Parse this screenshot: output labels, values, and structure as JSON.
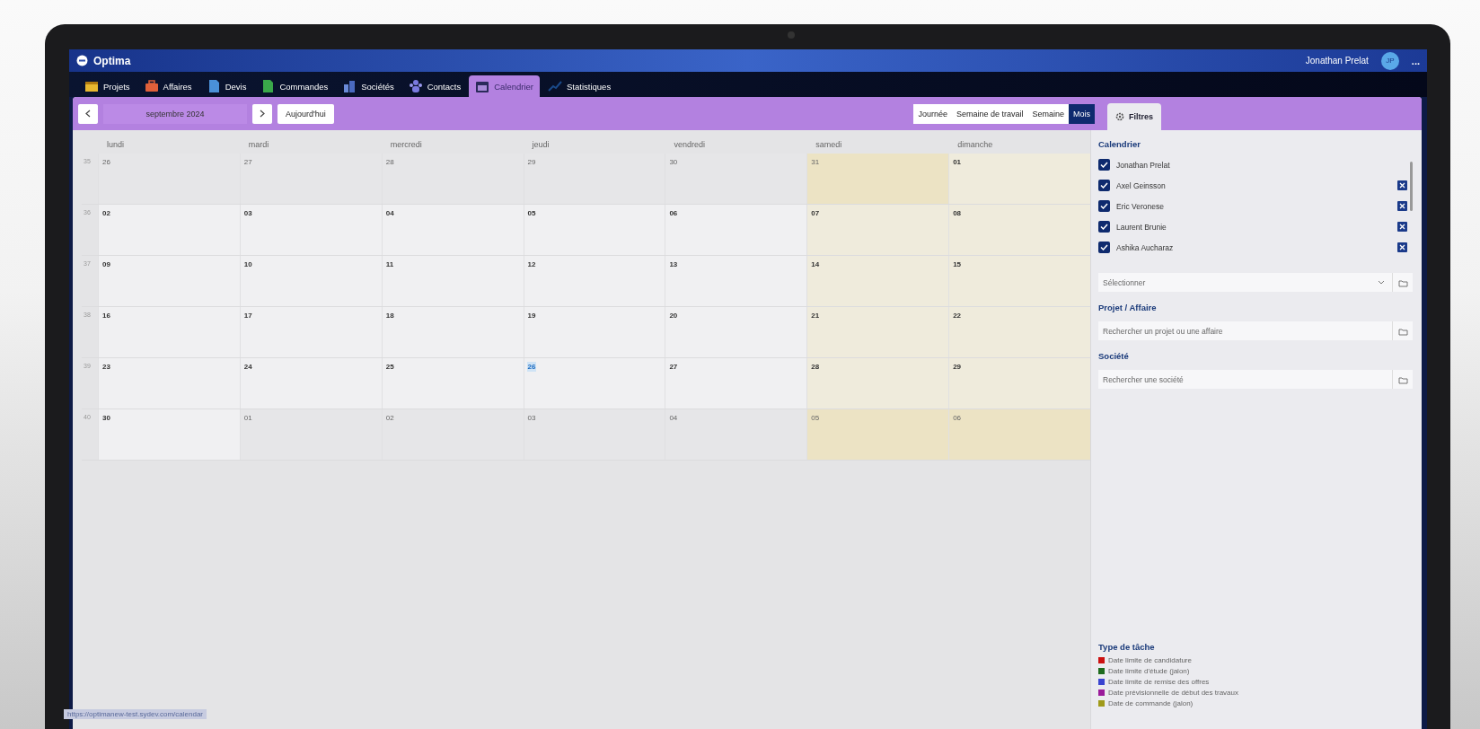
{
  "app": {
    "name": "Optima"
  },
  "user": {
    "name": "Jonathan Prelat",
    "initials": "JP",
    "menu": "..."
  },
  "nav": [
    {
      "label": "Projets",
      "selected": false
    },
    {
      "label": "Affaires",
      "selected": false
    },
    {
      "label": "Devis",
      "selected": false
    },
    {
      "label": "Commandes",
      "selected": false
    },
    {
      "label": "Sociétés",
      "selected": false
    },
    {
      "label": "Contacts",
      "selected": false
    },
    {
      "label": "Calendrier",
      "selected": true
    },
    {
      "label": "Statistiques",
      "selected": false
    }
  ],
  "toolbar": {
    "period": "septembre 2024",
    "today_button": "Aujourd'hui",
    "views": [
      {
        "label": "Journée",
        "selected": false
      },
      {
        "label": "Semaine de travail",
        "selected": false
      },
      {
        "label": "Semaine",
        "selected": false
      },
      {
        "label": "Mois",
        "selected": true
      }
    ]
  },
  "calendar": {
    "weekdays": [
      "lundi",
      "mardi",
      "mercredi",
      "jeudi",
      "vendredi",
      "samedi",
      "dimanche"
    ],
    "weeks": [
      {
        "number": "35",
        "days": [
          {
            "day": "26",
            "outside": true,
            "today": false
          },
          {
            "day": "27",
            "outside": true,
            "today": false
          },
          {
            "day": "28",
            "outside": true,
            "today": false
          },
          {
            "day": "29",
            "outside": true,
            "today": false
          },
          {
            "day": "30",
            "outside": true,
            "today": false
          },
          {
            "day": "31",
            "outside": true,
            "today": false
          },
          {
            "day": "01",
            "outside": false,
            "today": false
          }
        ]
      },
      {
        "number": "36",
        "days": [
          {
            "day": "02",
            "outside": false,
            "today": false
          },
          {
            "day": "03",
            "outside": false,
            "today": false
          },
          {
            "day": "04",
            "outside": false,
            "today": false
          },
          {
            "day": "05",
            "outside": false,
            "today": false
          },
          {
            "day": "06",
            "outside": false,
            "today": false
          },
          {
            "day": "07",
            "outside": false,
            "today": false
          },
          {
            "day": "08",
            "outside": false,
            "today": false
          }
        ]
      },
      {
        "number": "37",
        "days": [
          {
            "day": "09",
            "outside": false,
            "today": false
          },
          {
            "day": "10",
            "outside": false,
            "today": false
          },
          {
            "day": "11",
            "outside": false,
            "today": false
          },
          {
            "day": "12",
            "outside": false,
            "today": false
          },
          {
            "day": "13",
            "outside": false,
            "today": false
          },
          {
            "day": "14",
            "outside": false,
            "today": false
          },
          {
            "day": "15",
            "outside": false,
            "today": false
          }
        ]
      },
      {
        "number": "38",
        "days": [
          {
            "day": "16",
            "outside": false,
            "today": false
          },
          {
            "day": "17",
            "outside": false,
            "today": false
          },
          {
            "day": "18",
            "outside": false,
            "today": false
          },
          {
            "day": "19",
            "outside": false,
            "today": false
          },
          {
            "day": "20",
            "outside": false,
            "today": false
          },
          {
            "day": "21",
            "outside": false,
            "today": false
          },
          {
            "day": "22",
            "outside": false,
            "today": false
          }
        ]
      },
      {
        "number": "39",
        "days": [
          {
            "day": "23",
            "outside": false,
            "today": false
          },
          {
            "day": "24",
            "outside": false,
            "today": false
          },
          {
            "day": "25",
            "outside": false,
            "today": false
          },
          {
            "day": "26",
            "outside": false,
            "today": true
          },
          {
            "day": "27",
            "outside": false,
            "today": false
          },
          {
            "day": "28",
            "outside": false,
            "today": false
          },
          {
            "day": "29",
            "outside": false,
            "today": false
          }
        ]
      },
      {
        "number": "40",
        "days": [
          {
            "day": "30",
            "outside": false,
            "today": false
          },
          {
            "day": "01",
            "outside": true,
            "today": false
          },
          {
            "day": "02",
            "outside": true,
            "today": false
          },
          {
            "day": "03",
            "outside": true,
            "today": false
          },
          {
            "day": "04",
            "outside": true,
            "today": false
          },
          {
            "day": "05",
            "outside": true,
            "today": false
          },
          {
            "day": "06",
            "outside": true,
            "today": false
          }
        ]
      }
    ]
  },
  "filters": {
    "tab": "Filtres",
    "calendar_title": "Calendrier",
    "people": [
      {
        "name": "Jonathan Prelat",
        "checked": true,
        "removable": false
      },
      {
        "name": "Axel Geinsson",
        "checked": true,
        "removable": true
      },
      {
        "name": "Eric Veronese",
        "checked": true,
        "removable": true
      },
      {
        "name": "Laurent Brunie",
        "checked": true,
        "removable": true
      },
      {
        "name": "Ashika Aucharaz",
        "checked": true,
        "removable": true
      }
    ],
    "select_placeholder": "Sélectionner",
    "project_title": "Projet / Affaire",
    "project_placeholder": "Rechercher un projet ou une affaire",
    "company_title": "Société",
    "company_placeholder": "Rechercher une société",
    "legend_title": "Type de tâche",
    "legend": [
      {
        "label": "Date limite de candidature",
        "color": "#cc1111"
      },
      {
        "label": "Date limite d'étude (jalon)",
        "color": "#1e6b1e"
      },
      {
        "label": "Date limite de remise des offres",
        "color": "#3a44d0"
      },
      {
        "label": "Date prévisionnelle de début des travaux",
        "color": "#9a1a9a"
      },
      {
        "label": "Date de commande (jalon)",
        "color": "#a09a1a"
      }
    ]
  },
  "status_url": "https://optimanew-test.sydev.com/calendar"
}
